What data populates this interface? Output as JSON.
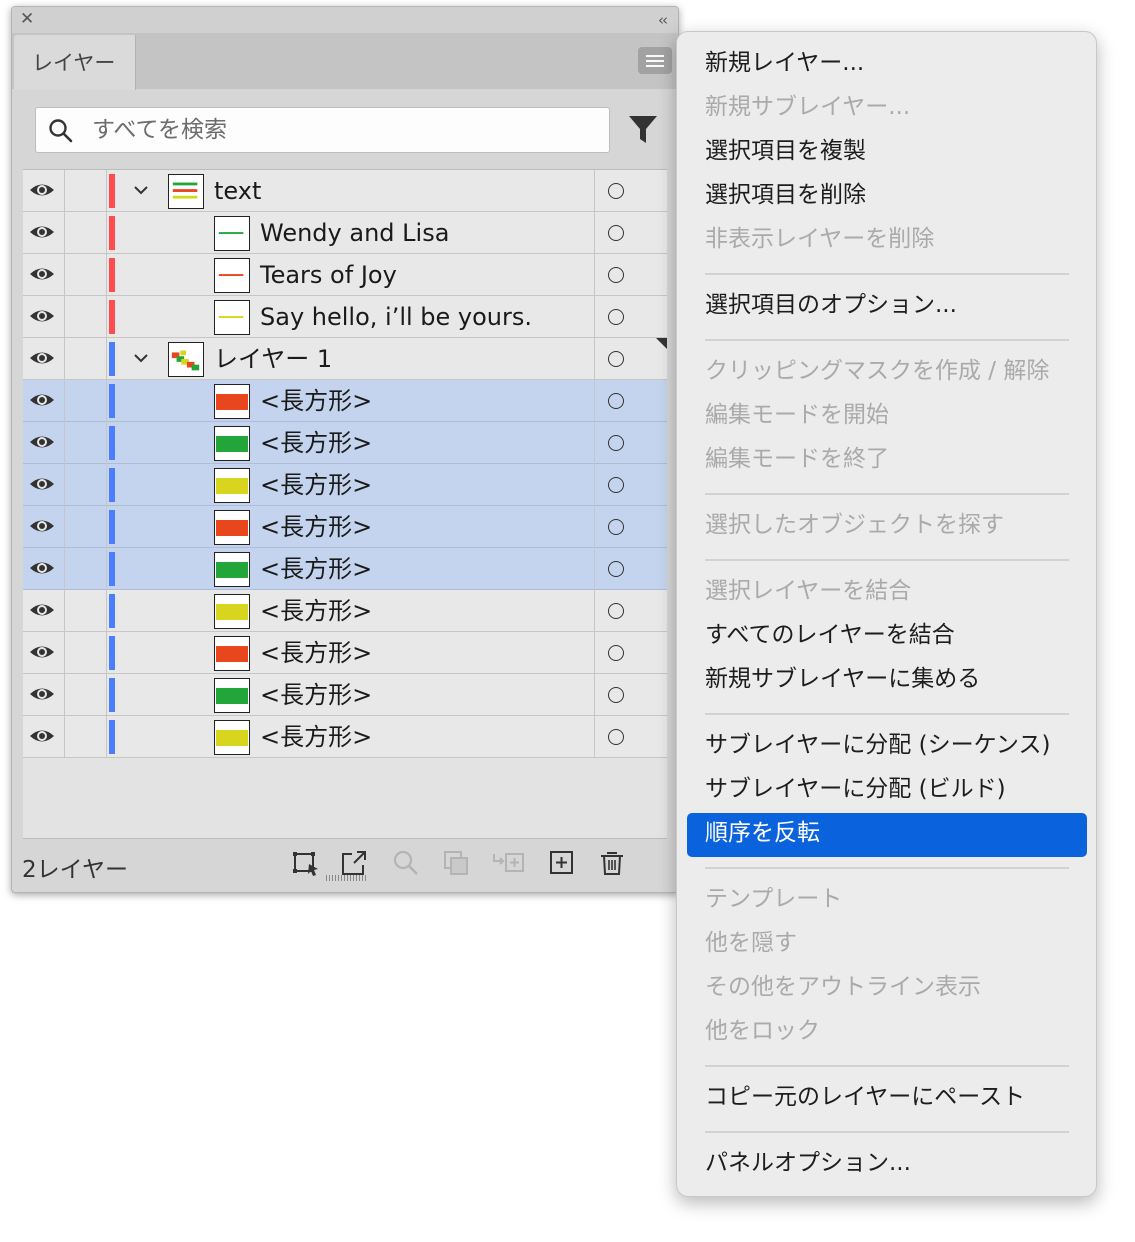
{
  "panel": {
    "tab_label": "レイヤー",
    "search": {
      "placeholder": "すべてを検索",
      "value": ""
    },
    "layer_count": "2レイヤー",
    "footer_icons": [
      "collect-for-export-icon",
      "export-icon",
      "locate-object-icon",
      "make-clipping-mask-icon",
      "create-sublayer-icon",
      "new-layer-icon",
      "trash-icon"
    ]
  },
  "rows": [
    {
      "name": "text",
      "level": 0,
      "expanded": true,
      "color": "#ff4d4d",
      "thumb": "text-preview",
      "selected": false
    },
    {
      "name": "Wendy and Lisa",
      "level": 1,
      "color": "#ff4d4d",
      "thumb": "text-small",
      "selected": false
    },
    {
      "name": "Tears of Joy",
      "level": 1,
      "color": "#ff4d4d",
      "thumb": "text-small-red",
      "selected": false
    },
    {
      "name": "Say hello, i’ll be yours.",
      "level": 1,
      "color": "#ff4d4d",
      "thumb": "text-small-yellow",
      "selected": false
    },
    {
      "name": "レイヤー 1",
      "level": 0,
      "expanded": true,
      "color": "#4a7dff",
      "thumb": "shapes-preview",
      "selected": false,
      "has_selection_corner": true
    },
    {
      "name": "<長方形>",
      "level": 1,
      "color": "#4a7dff",
      "fill": "#e8461c",
      "selected": true
    },
    {
      "name": "<長方形>",
      "level": 1,
      "color": "#4a7dff",
      "fill": "#22a63a",
      "selected": true
    },
    {
      "name": "<長方形>",
      "level": 1,
      "color": "#4a7dff",
      "fill": "#d8d51e",
      "selected": true
    },
    {
      "name": "<長方形>",
      "level": 1,
      "color": "#4a7dff",
      "fill": "#e8461c",
      "selected": true
    },
    {
      "name": "<長方形>",
      "level": 1,
      "color": "#4a7dff",
      "fill": "#22a63a",
      "selected": true
    },
    {
      "name": "<長方形>",
      "level": 1,
      "color": "#4a7dff",
      "fill": "#d8d51e",
      "selected": false
    },
    {
      "name": "<長方形>",
      "level": 1,
      "color": "#4a7dff",
      "fill": "#e8461c",
      "selected": false
    },
    {
      "name": "<長方形>",
      "level": 1,
      "color": "#4a7dff",
      "fill": "#22a63a",
      "selected": false
    },
    {
      "name": "<長方形>",
      "level": 1,
      "color": "#4a7dff",
      "fill": "#d8d51e",
      "selected": false
    }
  ],
  "menu": [
    {
      "label": "新規レイヤー...",
      "enabled": true
    },
    {
      "label": "新規サブレイヤー...",
      "enabled": false
    },
    {
      "label": "選択項目を複製",
      "enabled": true
    },
    {
      "label": "選択項目を削除",
      "enabled": true
    },
    {
      "label": "非表示レイヤーを削除",
      "enabled": false
    },
    {
      "sep": true
    },
    {
      "label": "選択項目のオプション...",
      "enabled": true
    },
    {
      "sep": true
    },
    {
      "label": "クリッピングマスクを作成 / 解除",
      "enabled": false
    },
    {
      "label": "編集モードを開始",
      "enabled": false
    },
    {
      "label": "編集モードを終了",
      "enabled": false
    },
    {
      "sep": true
    },
    {
      "label": "選択したオブジェクトを探す",
      "enabled": false
    },
    {
      "sep": true
    },
    {
      "label": "選択レイヤーを結合",
      "enabled": false
    },
    {
      "label": "すべてのレイヤーを結合",
      "enabled": true
    },
    {
      "label": "新規サブレイヤーに集める",
      "enabled": true
    },
    {
      "sep": true
    },
    {
      "label": "サブレイヤーに分配 (シーケンス)",
      "enabled": true
    },
    {
      "label": "サブレイヤーに分配 (ビルド)",
      "enabled": true
    },
    {
      "label": "順序を反転",
      "enabled": true,
      "highlighted": true
    },
    {
      "sep": true
    },
    {
      "label": "テンプレート",
      "enabled": false
    },
    {
      "label": "他を隠す",
      "enabled": false
    },
    {
      "label": "その他をアウトライン表示",
      "enabled": false
    },
    {
      "label": "他をロック",
      "enabled": false
    },
    {
      "sep": true
    },
    {
      "label": "コピー元のレイヤーにペースト",
      "enabled": true
    },
    {
      "sep": true
    },
    {
      "label": "パネルオプション...",
      "enabled": true
    }
  ]
}
